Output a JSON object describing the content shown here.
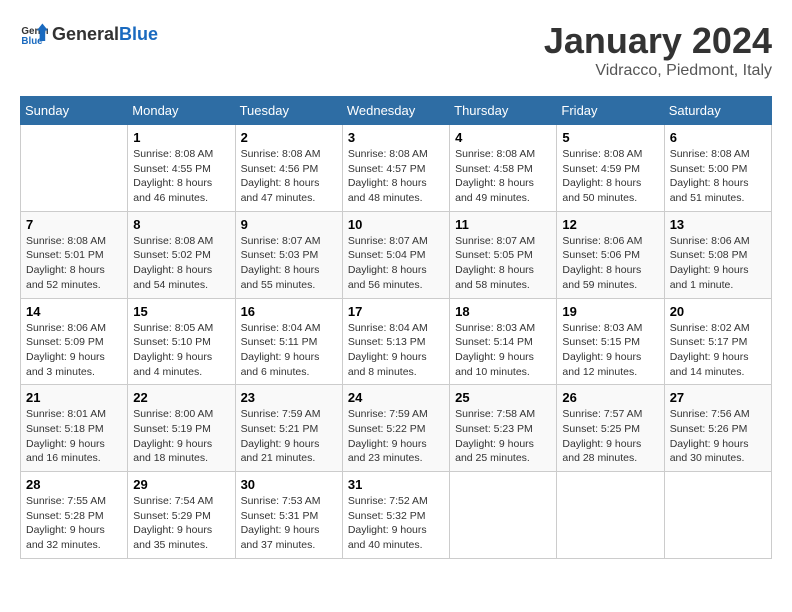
{
  "header": {
    "logo_general": "General",
    "logo_blue": "Blue",
    "month": "January 2024",
    "location": "Vidracco, Piedmont, Italy"
  },
  "weekdays": [
    "Sunday",
    "Monday",
    "Tuesday",
    "Wednesday",
    "Thursday",
    "Friday",
    "Saturday"
  ],
  "weeks": [
    [
      {
        "day": "",
        "sunrise": "",
        "sunset": "",
        "daylight": ""
      },
      {
        "day": "1",
        "sunrise": "Sunrise: 8:08 AM",
        "sunset": "Sunset: 4:55 PM",
        "daylight": "Daylight: 8 hours and 46 minutes."
      },
      {
        "day": "2",
        "sunrise": "Sunrise: 8:08 AM",
        "sunset": "Sunset: 4:56 PM",
        "daylight": "Daylight: 8 hours and 47 minutes."
      },
      {
        "day": "3",
        "sunrise": "Sunrise: 8:08 AM",
        "sunset": "Sunset: 4:57 PM",
        "daylight": "Daylight: 8 hours and 48 minutes."
      },
      {
        "day": "4",
        "sunrise": "Sunrise: 8:08 AM",
        "sunset": "Sunset: 4:58 PM",
        "daylight": "Daylight: 8 hours and 49 minutes."
      },
      {
        "day": "5",
        "sunrise": "Sunrise: 8:08 AM",
        "sunset": "Sunset: 4:59 PM",
        "daylight": "Daylight: 8 hours and 50 minutes."
      },
      {
        "day": "6",
        "sunrise": "Sunrise: 8:08 AM",
        "sunset": "Sunset: 5:00 PM",
        "daylight": "Daylight: 8 hours and 51 minutes."
      }
    ],
    [
      {
        "day": "7",
        "sunrise": "Sunrise: 8:08 AM",
        "sunset": "Sunset: 5:01 PM",
        "daylight": "Daylight: 8 hours and 52 minutes."
      },
      {
        "day": "8",
        "sunrise": "Sunrise: 8:08 AM",
        "sunset": "Sunset: 5:02 PM",
        "daylight": "Daylight: 8 hours and 54 minutes."
      },
      {
        "day": "9",
        "sunrise": "Sunrise: 8:07 AM",
        "sunset": "Sunset: 5:03 PM",
        "daylight": "Daylight: 8 hours and 55 minutes."
      },
      {
        "day": "10",
        "sunrise": "Sunrise: 8:07 AM",
        "sunset": "Sunset: 5:04 PM",
        "daylight": "Daylight: 8 hours and 56 minutes."
      },
      {
        "day": "11",
        "sunrise": "Sunrise: 8:07 AM",
        "sunset": "Sunset: 5:05 PM",
        "daylight": "Daylight: 8 hours and 58 minutes."
      },
      {
        "day": "12",
        "sunrise": "Sunrise: 8:06 AM",
        "sunset": "Sunset: 5:06 PM",
        "daylight": "Daylight: 8 hours and 59 minutes."
      },
      {
        "day": "13",
        "sunrise": "Sunrise: 8:06 AM",
        "sunset": "Sunset: 5:08 PM",
        "daylight": "Daylight: 9 hours and 1 minute."
      }
    ],
    [
      {
        "day": "14",
        "sunrise": "Sunrise: 8:06 AM",
        "sunset": "Sunset: 5:09 PM",
        "daylight": "Daylight: 9 hours and 3 minutes."
      },
      {
        "day": "15",
        "sunrise": "Sunrise: 8:05 AM",
        "sunset": "Sunset: 5:10 PM",
        "daylight": "Daylight: 9 hours and 4 minutes."
      },
      {
        "day": "16",
        "sunrise": "Sunrise: 8:04 AM",
        "sunset": "Sunset: 5:11 PM",
        "daylight": "Daylight: 9 hours and 6 minutes."
      },
      {
        "day": "17",
        "sunrise": "Sunrise: 8:04 AM",
        "sunset": "Sunset: 5:13 PM",
        "daylight": "Daylight: 9 hours and 8 minutes."
      },
      {
        "day": "18",
        "sunrise": "Sunrise: 8:03 AM",
        "sunset": "Sunset: 5:14 PM",
        "daylight": "Daylight: 9 hours and 10 minutes."
      },
      {
        "day": "19",
        "sunrise": "Sunrise: 8:03 AM",
        "sunset": "Sunset: 5:15 PM",
        "daylight": "Daylight: 9 hours and 12 minutes."
      },
      {
        "day": "20",
        "sunrise": "Sunrise: 8:02 AM",
        "sunset": "Sunset: 5:17 PM",
        "daylight": "Daylight: 9 hours and 14 minutes."
      }
    ],
    [
      {
        "day": "21",
        "sunrise": "Sunrise: 8:01 AM",
        "sunset": "Sunset: 5:18 PM",
        "daylight": "Daylight: 9 hours and 16 minutes."
      },
      {
        "day": "22",
        "sunrise": "Sunrise: 8:00 AM",
        "sunset": "Sunset: 5:19 PM",
        "daylight": "Daylight: 9 hours and 18 minutes."
      },
      {
        "day": "23",
        "sunrise": "Sunrise: 7:59 AM",
        "sunset": "Sunset: 5:21 PM",
        "daylight": "Daylight: 9 hours and 21 minutes."
      },
      {
        "day": "24",
        "sunrise": "Sunrise: 7:59 AM",
        "sunset": "Sunset: 5:22 PM",
        "daylight": "Daylight: 9 hours and 23 minutes."
      },
      {
        "day": "25",
        "sunrise": "Sunrise: 7:58 AM",
        "sunset": "Sunset: 5:23 PM",
        "daylight": "Daylight: 9 hours and 25 minutes."
      },
      {
        "day": "26",
        "sunrise": "Sunrise: 7:57 AM",
        "sunset": "Sunset: 5:25 PM",
        "daylight": "Daylight: 9 hours and 28 minutes."
      },
      {
        "day": "27",
        "sunrise": "Sunrise: 7:56 AM",
        "sunset": "Sunset: 5:26 PM",
        "daylight": "Daylight: 9 hours and 30 minutes."
      }
    ],
    [
      {
        "day": "28",
        "sunrise": "Sunrise: 7:55 AM",
        "sunset": "Sunset: 5:28 PM",
        "daylight": "Daylight: 9 hours and 32 minutes."
      },
      {
        "day": "29",
        "sunrise": "Sunrise: 7:54 AM",
        "sunset": "Sunset: 5:29 PM",
        "daylight": "Daylight: 9 hours and 35 minutes."
      },
      {
        "day": "30",
        "sunrise": "Sunrise: 7:53 AM",
        "sunset": "Sunset: 5:31 PM",
        "daylight": "Daylight: 9 hours and 37 minutes."
      },
      {
        "day": "31",
        "sunrise": "Sunrise: 7:52 AM",
        "sunset": "Sunset: 5:32 PM",
        "daylight": "Daylight: 9 hours and 40 minutes."
      },
      {
        "day": "",
        "sunrise": "",
        "sunset": "",
        "daylight": ""
      },
      {
        "day": "",
        "sunrise": "",
        "sunset": "",
        "daylight": ""
      },
      {
        "day": "",
        "sunrise": "",
        "sunset": "",
        "daylight": ""
      }
    ]
  ]
}
